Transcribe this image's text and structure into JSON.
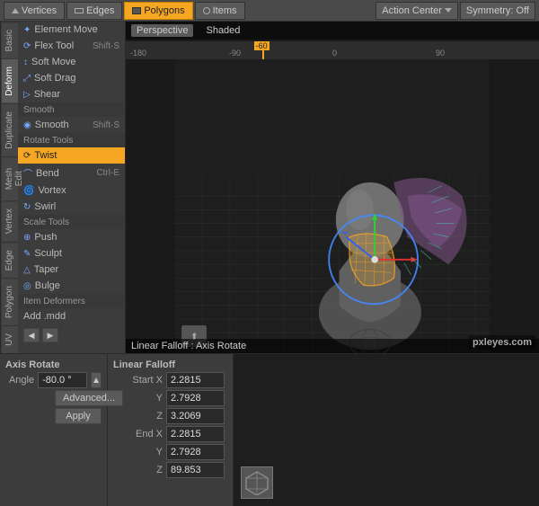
{
  "toolbar": {
    "tabs": [
      {
        "label": "Vertices",
        "icon": "vertex",
        "active": false
      },
      {
        "label": "Edges",
        "icon": "edge",
        "active": false
      },
      {
        "label": "Polygons",
        "icon": "polygon",
        "active": true
      },
      {
        "label": "Items",
        "icon": "item",
        "active": false
      }
    ],
    "action_center": "Action Center",
    "symmetry": "Symmetry: Off"
  },
  "viewport": {
    "tabs": [
      "Perspective",
      "Shaded"
    ],
    "active_tab": "Perspective",
    "ruler_labels": [
      "-180",
      "-90",
      "0",
      "90"
    ],
    "marker_value": "-60"
  },
  "sidebar": {
    "sections": [
      {
        "label": "",
        "items": [
          {
            "label": "Element Move",
            "shortcut": "",
            "active": false,
            "icon": "move"
          },
          {
            "label": "Flex Tool",
            "shortcut": "Shift-S",
            "active": false,
            "icon": "flex"
          },
          {
            "label": "Soft Move",
            "shortcut": "",
            "active": false,
            "icon": "softmove"
          },
          {
            "label": "Soft Drag",
            "shortcut": "",
            "active": false,
            "icon": "softdrag"
          },
          {
            "label": "Shear",
            "shortcut": "",
            "active": false,
            "icon": "shear"
          }
        ]
      },
      {
        "label": "Smooth",
        "items": [
          {
            "label": "Smooth",
            "shortcut": "Shift-S",
            "active": false,
            "icon": "smooth"
          }
        ]
      },
      {
        "label": "Rotate Tools",
        "items": [
          {
            "label": "Twist",
            "shortcut": "",
            "active": true,
            "icon": "twist"
          },
          {
            "label": "Bend",
            "shortcut": "Ctrl-E",
            "active": false,
            "icon": "bend"
          },
          {
            "label": "Vortex",
            "shortcut": "",
            "active": false,
            "icon": "vortex"
          },
          {
            "label": "Swirl",
            "shortcut": "",
            "active": false,
            "icon": "swirl"
          }
        ]
      },
      {
        "label": "Scale Tools",
        "items": [
          {
            "label": "Push",
            "shortcut": "",
            "active": false,
            "icon": "push"
          },
          {
            "label": "Sculpt",
            "shortcut": "",
            "active": false,
            "icon": "sculpt"
          },
          {
            "label": "Taper",
            "shortcut": "",
            "active": false,
            "icon": "taper"
          },
          {
            "label": "Bulge",
            "shortcut": "",
            "active": false,
            "icon": "bulge"
          }
        ]
      },
      {
        "label": "Item Deformers",
        "items": [
          {
            "label": "Add .mdd",
            "shortcut": "",
            "active": false,
            "icon": "add"
          }
        ]
      }
    ]
  },
  "vertical_tabs": [
    "Basic",
    "Deform",
    "Duplicate",
    "Mesh Edit",
    "Vertex",
    "Edge",
    "Polygon",
    "UV"
  ],
  "active_vtab": "Deform",
  "bottom_panel": {
    "axis_rotate": {
      "title": "Axis Rotate",
      "angle_label": "Angle",
      "angle_value": "-80.0 °",
      "advanced_label": "Advanced...",
      "apply_label": "Apply"
    },
    "linear_falloff": {
      "title": "Linear Falloff",
      "start_label": "Start X",
      "start_x": "2.2815",
      "start_y": "2.7928",
      "start_z": "3.2069",
      "end_label": "End X",
      "end_x": "2.2815",
      "end_y": "2.7928",
      "end_z": "89.853"
    }
  },
  "status_bar": {
    "message": "Linear Falloff : Axis Rotate"
  },
  "watermark": "pxleyes.com"
}
